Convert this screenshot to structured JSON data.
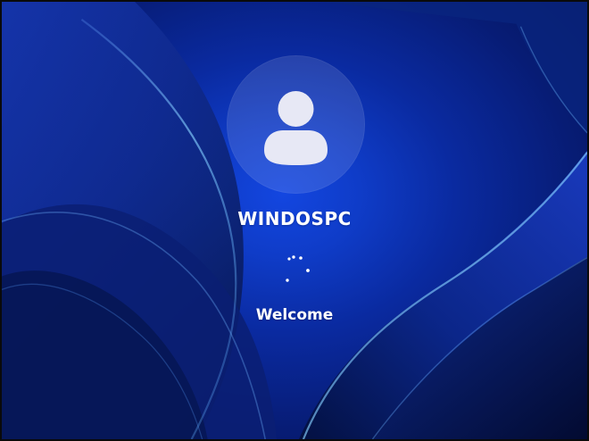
{
  "screen": {
    "type": "windows-login-screen",
    "accent_color": "#0f3cc8",
    "text_color": "#ffffff"
  },
  "user": {
    "name": "WINDOSPC",
    "avatar_icon": "person-icon"
  },
  "status": {
    "message": "Welcome",
    "spinner_icon": "loading-spinner-icon"
  }
}
